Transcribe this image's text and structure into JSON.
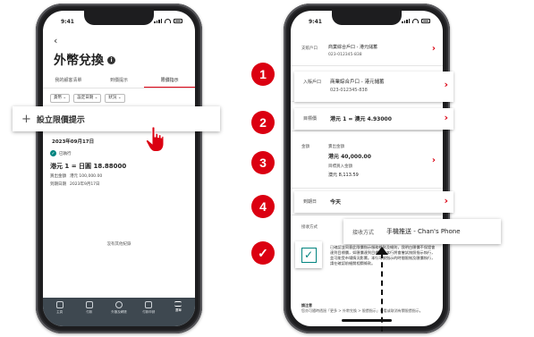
{
  "status_time": "9:41",
  "left": {
    "back_symbol": "‹",
    "title": "外幣兌換",
    "tabs": [
      "我的顧客清單",
      "到價提示",
      "限價指示"
    ],
    "filters": [
      "貨幣 ⌄",
      "設定日期 ⌄",
      "狀況 ⌄"
    ],
    "section_date": "2023年09月17日",
    "alert": {
      "status": "已執行",
      "rate": "港元 1 = 日圓 18.88000",
      "rows": [
        {
          "k": "買出金額",
          "v": "港元 100,000.00"
        },
        {
          "k": "到期日期",
          "v": "2023年9月17日"
        }
      ]
    },
    "no_more": "沒有其他紀錄",
    "nav": [
      {
        "label": "主頁",
        "icon": "home-icon"
      },
      {
        "label": "付款",
        "icon": "payments-icon"
      },
      {
        "label": "外匯及轉賬",
        "icon": "transfer-icon"
      },
      {
        "label": "付款申請",
        "icon": "requests-icon"
      },
      {
        "label": "選單",
        "icon": "menu-icon"
      }
    ],
    "callout_label": "設立限價提示"
  },
  "right": {
    "from_account": {
      "label": "支賬戶口",
      "name": "商業綜合戶口 - 港元儲蓄",
      "number": "023-012345-838"
    },
    "to_account": {
      "label": "入賬戶口",
      "name": "商業綜合戶口 - 港元儲蓄",
      "number": "023-012345-838"
    },
    "target_rate": {
      "label": "目標價",
      "value": "港元 1 = 澳元 4.93000"
    },
    "amount": {
      "label": "金額",
      "sell_label": "賣出金額",
      "sell_value": "港元 40,000.00",
      "buy_label": "目標買入金額",
      "buy_value": "澳元 8,113.59"
    },
    "expiry": {
      "label": "到期日",
      "value": "今天"
    },
    "method": {
      "label": "接收方式",
      "value": "手機推送 - Chan's Phone"
    },
    "terms": "已確認並同意此限價指示服務條款及細則，我明白匯價不保證會達到目標價，如匯價達到目標價，本行將會嘗試按照指示執行，並可能受市場情況影響。本行可按指示的時間限制及匯價執行，請在確認前細閱相關條款。",
    "note_title": "請注意",
    "note": "您亦可隨時透過「更多 > 外幣兌換 > 限價指示」查看或取消有關限價指示。",
    "chevron": "›"
  },
  "steps": [
    "1",
    "2",
    "3",
    "4",
    "✓"
  ],
  "checkbox_mark": "✓",
  "colors": {
    "brand_red": "#db0011",
    "teal": "#00847f",
    "nav_bg": "#3e4850"
  }
}
